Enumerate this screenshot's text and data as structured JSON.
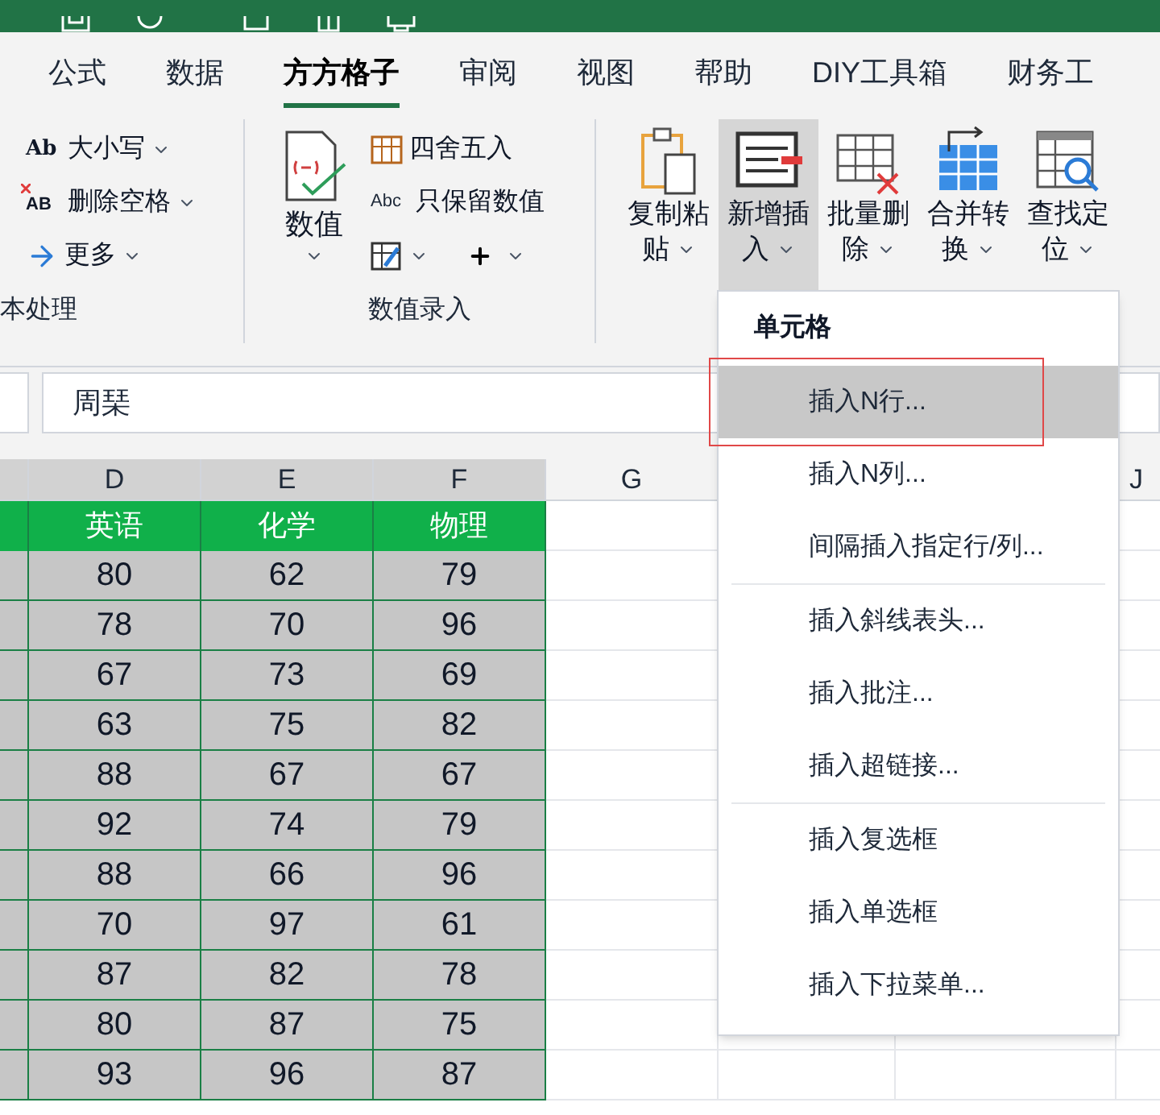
{
  "tabs": [
    {
      "label": "公式",
      "selected": false
    },
    {
      "label": "数据",
      "selected": false
    },
    {
      "label": "方方格子",
      "selected": true
    },
    {
      "label": "审阅",
      "selected": false
    },
    {
      "label": "视图",
      "selected": false
    },
    {
      "label": "帮助",
      "selected": false
    },
    {
      "label": "DIY工具箱",
      "selected": false
    },
    {
      "label": "财务工",
      "selected": false
    }
  ],
  "ribbon": {
    "text_group": {
      "label": "本处理",
      "items": [
        {
          "kind": "case",
          "badge": "Ab",
          "label": "大小写"
        },
        {
          "kind": "trim",
          "badge": "AB",
          "label": "删除空格"
        },
        {
          "kind": "more",
          "label": "更多"
        }
      ]
    },
    "number_group": {
      "label": "数值录入",
      "big": {
        "label": "数值"
      },
      "items": [
        {
          "kind": "round",
          "label": "四舍五入"
        },
        {
          "kind": "keep",
          "badge": "Abc",
          "label": "只保留数值"
        }
      ]
    },
    "buttons": [
      {
        "kind": "paste",
        "lines": [
          "复制粘",
          "贴"
        ],
        "selected": false
      },
      {
        "kind": "insert",
        "lines": [
          "新增插",
          "入"
        ],
        "selected": true
      },
      {
        "kind": "delete",
        "lines": [
          "批量删",
          "除"
        ],
        "selected": false
      },
      {
        "kind": "merge",
        "lines": [
          "合并转",
          "换"
        ],
        "selected": false
      },
      {
        "kind": "find",
        "lines": [
          "查找定",
          "位"
        ],
        "selected": false
      }
    ]
  },
  "formula_bar": {
    "value": "周琹"
  },
  "sheet": {
    "columns": [
      {
        "letter": "D",
        "selected": true
      },
      {
        "letter": "E",
        "selected": true
      },
      {
        "letter": "F",
        "selected": true
      },
      {
        "letter": "G",
        "selected": false
      },
      {
        "letter": "J",
        "selected": false
      }
    ],
    "headers": [
      "英语",
      "化学",
      "物理"
    ],
    "rows": [
      [
        "80",
        "62",
        "79"
      ],
      [
        "78",
        "70",
        "96"
      ],
      [
        "67",
        "73",
        "69"
      ],
      [
        "63",
        "75",
        "82"
      ],
      [
        "88",
        "67",
        "67"
      ],
      [
        "92",
        "74",
        "79"
      ],
      [
        "88",
        "66",
        "96"
      ],
      [
        "70",
        "97",
        "61"
      ],
      [
        "87",
        "82",
        "78"
      ],
      [
        "80",
        "87",
        "75"
      ],
      [
        "93",
        "96",
        "87"
      ]
    ]
  },
  "menu": {
    "title": "单元格",
    "groups": [
      [
        {
          "label": "插入N行...",
          "selected": true
        },
        {
          "label": "插入N列...",
          "selected": false
        },
        {
          "label": "间隔插入指定行/列...",
          "selected": false
        }
      ],
      [
        {
          "label": "插入斜线表头...",
          "selected": false
        },
        {
          "label": "插入批注...",
          "selected": false
        },
        {
          "label": "插入超链接...",
          "selected": false
        }
      ],
      [
        {
          "label": "插入复选框",
          "selected": false
        },
        {
          "label": "插入单选框",
          "selected": false
        },
        {
          "label": "插入下拉菜单...",
          "selected": false
        }
      ]
    ]
  }
}
